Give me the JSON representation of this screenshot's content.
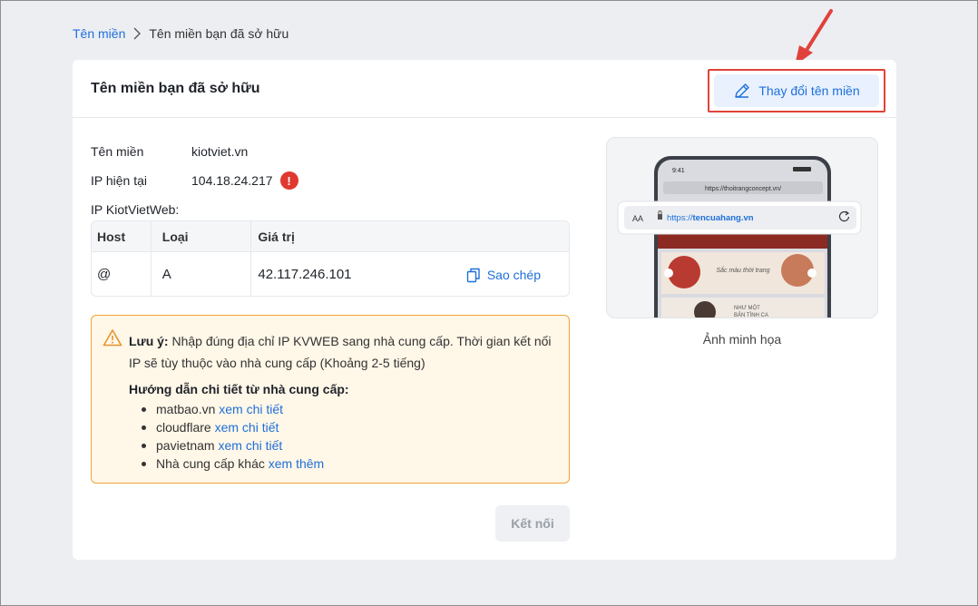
{
  "breadcrumb": {
    "root": "Tên miền",
    "current": "Tên miền bạn đã sở hữu"
  },
  "card": {
    "title": "Tên miền bạn đã sở hữu",
    "change_button": "Thay đổi tên miền"
  },
  "info": {
    "domain_label": "Tên miền",
    "domain_value": "kiotviet.vn",
    "ip_label": "IP hiện tại",
    "ip_value": "104.18.24.217",
    "ip_warning": "!",
    "kvweb_label": "IP KiotVietWeb:"
  },
  "table": {
    "headers": [
      "Host",
      "Loại",
      "Giá trị"
    ],
    "row": {
      "host": "@",
      "type": "A",
      "value": "42.117.246.101",
      "copy": "Sao chép"
    }
  },
  "note": {
    "prefix": "Lưu ý:",
    "text": " Nhập đúng địa chỉ IP KVWEB sang nhà cung cấp. Thời gian kết nối IP sẽ tùy thuộc vào nhà cung cấp (Khoảng 2-5 tiếng)",
    "guide_title": "Hướng dẫn chi tiết từ nhà cung cấp:",
    "providers": [
      {
        "name": "matbao.vn ",
        "link": "xem chi tiết"
      },
      {
        "name": "cloudflare ",
        "link": "xem chi tiết"
      },
      {
        "name": "pavietnam ",
        "link": "xem chi tiết"
      },
      {
        "name": "Nhà cung cấp khác ",
        "link": "xem thêm"
      }
    ]
  },
  "connect_button": "Kết nối",
  "illustration": {
    "caption": "Ảnh minh họa",
    "phone_time": "9:41",
    "phone_url": "https://thoitrangconcept.vn/",
    "url_bar_aa": "AA",
    "url_bar_prefix": "https://",
    "url_bar_domain": "tencuahang.vn",
    "banner1": "Sắc màu thời trang",
    "banner2a": "NHƯ MỘT",
    "banner2b": "BẢN TÌNH CA"
  },
  "colors": {
    "accent": "#1e6fd9",
    "danger": "#e0392f",
    "warning_border": "#f0a535",
    "annotation": "#e0423b"
  }
}
